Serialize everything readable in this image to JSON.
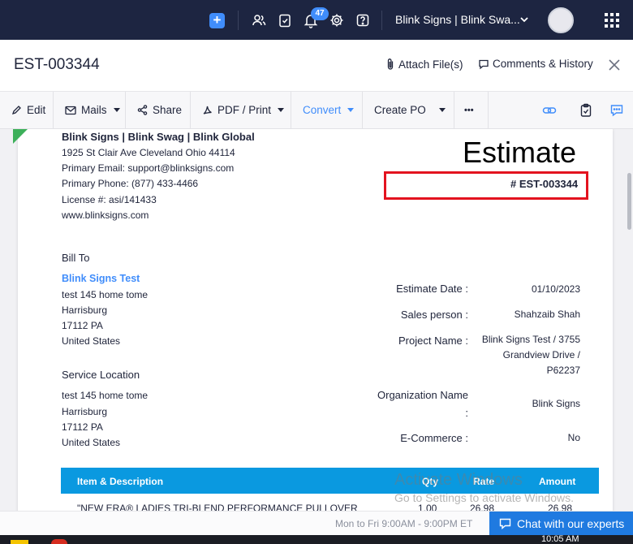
{
  "topbar": {
    "notification_count": "47",
    "org_switcher": "Blink Signs | Blink Swa...",
    "icons": [
      "plus-icon",
      "contacts-icon",
      "tasks-icon",
      "bell-icon",
      "gear-icon",
      "help-icon",
      "chevron-down-icon",
      "avatar",
      "apps-grid-icon"
    ]
  },
  "header": {
    "doc_id": "EST-003344",
    "attach_label": "Attach File(s)",
    "comments_label": "Comments & History"
  },
  "toolbar": {
    "edit": "Edit",
    "mails": "Mails",
    "share": "Share",
    "pdf_print": "PDF / Print",
    "convert": "Convert",
    "create_po": "Create PO",
    "more": "•••"
  },
  "document": {
    "org_name": "Blink Signs | Blink Swag | Blink Global",
    "address": "1925 St Clair Ave Cleveland Ohio 44114",
    "email": "Primary Email: support@blinksigns.com",
    "phone": "Primary Phone: (877) 433-4466",
    "license": "License #: asi/141433",
    "website": "www.blinksigns.com",
    "title": "Estimate",
    "number": "# EST-003344",
    "bill_to_heading": "Bill To",
    "customer_name": "Blink Signs Test",
    "bill_to": [
      "test 145 home tome",
      "Harrisburg",
      "17112 PA",
      "United States"
    ],
    "service_heading": "Service Location",
    "service": [
      "test 145 home tome",
      "Harrisburg",
      "17112 PA",
      "United States"
    ],
    "fields": {
      "estimate_date_label": "Estimate Date :",
      "estimate_date": "01/10/2023",
      "sales_person_label": "Sales person :",
      "sales_person": "Shahzaib Shah",
      "project_name_label": "Project Name :",
      "project_name_1": "Blink Signs Test / 3755",
      "project_name_2": "Grandview Drive /",
      "project_name_3": "P62237",
      "org_name_label": "Organization Name",
      "org_name_colon": ":",
      "org_name_value": "Blink Signs",
      "ecommerce_label": "E-Commerce :",
      "ecommerce_value": "No"
    },
    "table": {
      "headers": [
        "Item & Description",
        "Qty",
        "Rate",
        "Amount"
      ],
      "first_row": {
        "description": "\"NEW ERA® LADIES TRI-BLEND PERFORMANCE PULLOVER",
        "qty": "1.00",
        "rate": "26.98",
        "amount": "26.98"
      }
    }
  },
  "windows_watermark": {
    "line1": "Activate Windows",
    "line2": "Go to Settings to activate Windows."
  },
  "support": {
    "hours": "Mon to Fri 9:00AM - 9:00PM ET",
    "chat_label": "Chat with our experts"
  },
  "taskbar": {
    "time": "10:05 AM"
  },
  "colors": {
    "topbar_bg": "#1d2541",
    "accent_blue": "#408dfb",
    "table_header": "#0a99e0",
    "highlight_red": "#e3131f",
    "ribbon_green": "#3db05a"
  }
}
